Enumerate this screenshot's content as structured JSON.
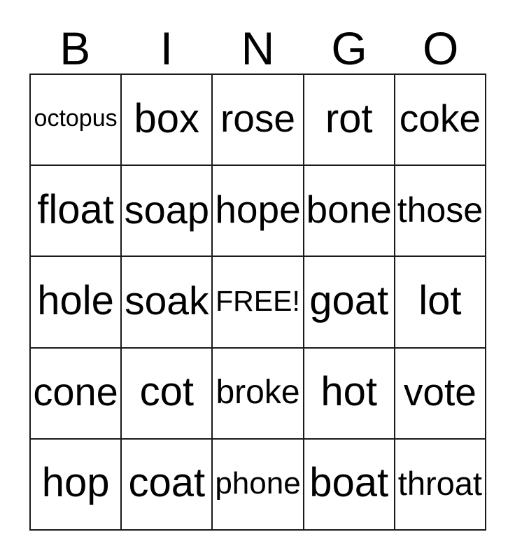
{
  "card": {
    "header": {
      "letters": [
        "B",
        "I",
        "N",
        "G",
        "O"
      ]
    },
    "colors": {
      "background": "#ffffff",
      "text": "#000000",
      "grid_line": "#1a1a1a"
    },
    "grid": {
      "columns": 5,
      "rows": 5,
      "free_space": "FREE!",
      "free_space_position": {
        "row": 3,
        "column": 3
      },
      "cells": [
        [
          {
            "label": "octopus",
            "font_size": 34
          },
          {
            "label": "box",
            "font_size": 58
          },
          {
            "label": "rose",
            "font_size": 55
          },
          {
            "label": "rot",
            "font_size": 58
          },
          {
            "label": "coke",
            "font_size": 55
          }
        ],
        [
          {
            "label": "float",
            "font_size": 58
          },
          {
            "label": "soap",
            "font_size": 58
          },
          {
            "label": "hope",
            "font_size": 58
          },
          {
            "label": "bone",
            "font_size": 58
          },
          {
            "label": "those",
            "font_size": 54
          }
        ],
        [
          {
            "label": "hole",
            "font_size": 58
          },
          {
            "label": "soak",
            "font_size": 58
          },
          {
            "label": "FREE!",
            "font_size": 42
          },
          {
            "label": "goat",
            "font_size": 58
          },
          {
            "label": "lot",
            "font_size": 58
          }
        ],
        [
          {
            "label": "cone",
            "font_size": 58
          },
          {
            "label": "cot",
            "font_size": 58
          },
          {
            "label": "broke",
            "font_size": 50
          },
          {
            "label": "hot",
            "font_size": 58
          },
          {
            "label": "vote",
            "font_size": 55
          }
        ],
        [
          {
            "label": "hop",
            "font_size": 58
          },
          {
            "label": "coat",
            "font_size": 58
          },
          {
            "label": "phone",
            "font_size": 45
          },
          {
            "label": "boat",
            "font_size": 58
          },
          {
            "label": "throat",
            "font_size": 48
          }
        ]
      ]
    }
  }
}
